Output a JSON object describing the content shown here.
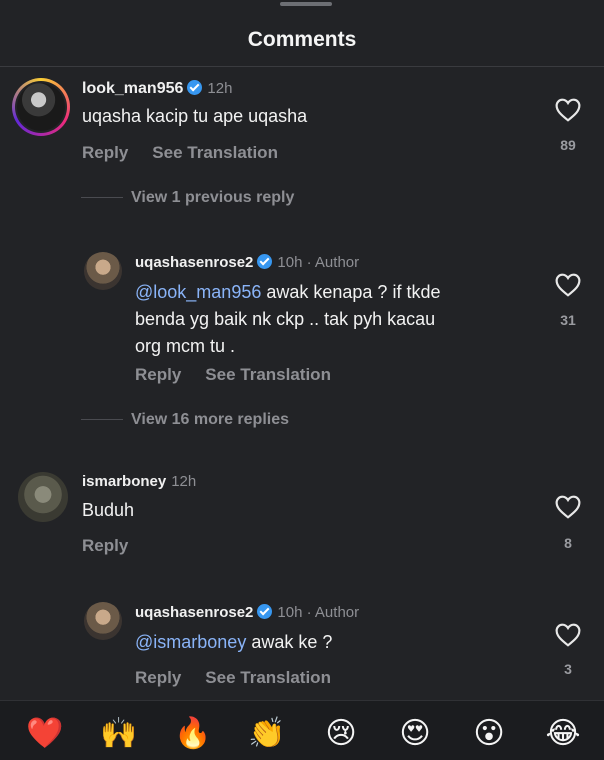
{
  "header": {
    "title": "Comments"
  },
  "comments": [
    {
      "username": "look_man956",
      "time": "12h",
      "text": "uqasha kacip tu ape uqasha",
      "reply_label": "Reply",
      "translate_label": "See Translation",
      "likes": "89",
      "view_replies": "View 1 previous reply"
    },
    {
      "username": "uqashasenrose2",
      "time": "10h",
      "author_tag": "· Author",
      "mention": "@look_man956",
      "text_line1": " awak kenapa ? if tkde",
      "text_line2": "benda yg baik nk ckp .. tak pyh kacau",
      "text_line3": "org mcm tu .",
      "reply_label": "Reply",
      "translate_label": "See Translation",
      "likes": "31",
      "view_replies": "View 16 more replies"
    },
    {
      "username": "ismarboney",
      "time": "12h",
      "text": "Buduh",
      "reply_label": "Reply",
      "likes": "8"
    },
    {
      "username": "uqashasenrose2",
      "time": "10h",
      "author_tag": "· Author",
      "mention": "@ismarboney",
      "text": " awak ke ?",
      "reply_label": "Reply",
      "translate_label": "See Translation",
      "likes": "3"
    }
  ],
  "emoji_bar": [
    "❤️",
    "🙌",
    "🔥",
    "👏",
    "😢",
    "😍",
    "😮",
    "😂"
  ]
}
